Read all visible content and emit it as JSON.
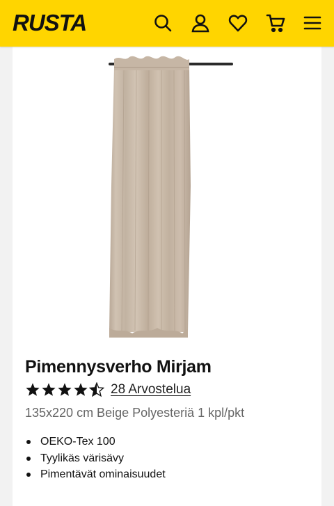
{
  "header": {
    "logo_text": "RUSTA",
    "background_color": "#ffd500",
    "icons": [
      "search-icon",
      "account-icon",
      "wishlist-heart-icon",
      "cart-icon",
      "menu-icon"
    ]
  },
  "product": {
    "title": "Pimennysverho Mirjam",
    "rating": {
      "stars": 4.5,
      "max_stars": 5,
      "reviews_label": "28 Arvostelua"
    },
    "subtitle": "135x220 cm Beige Polyesteriä 1 kpl/pkt",
    "features": [
      "OEKO-Tex 100",
      "Tyylikäs värisävy",
      "Pimentävät ominaisuudet"
    ],
    "image_description_color": "#c8b9a8"
  }
}
